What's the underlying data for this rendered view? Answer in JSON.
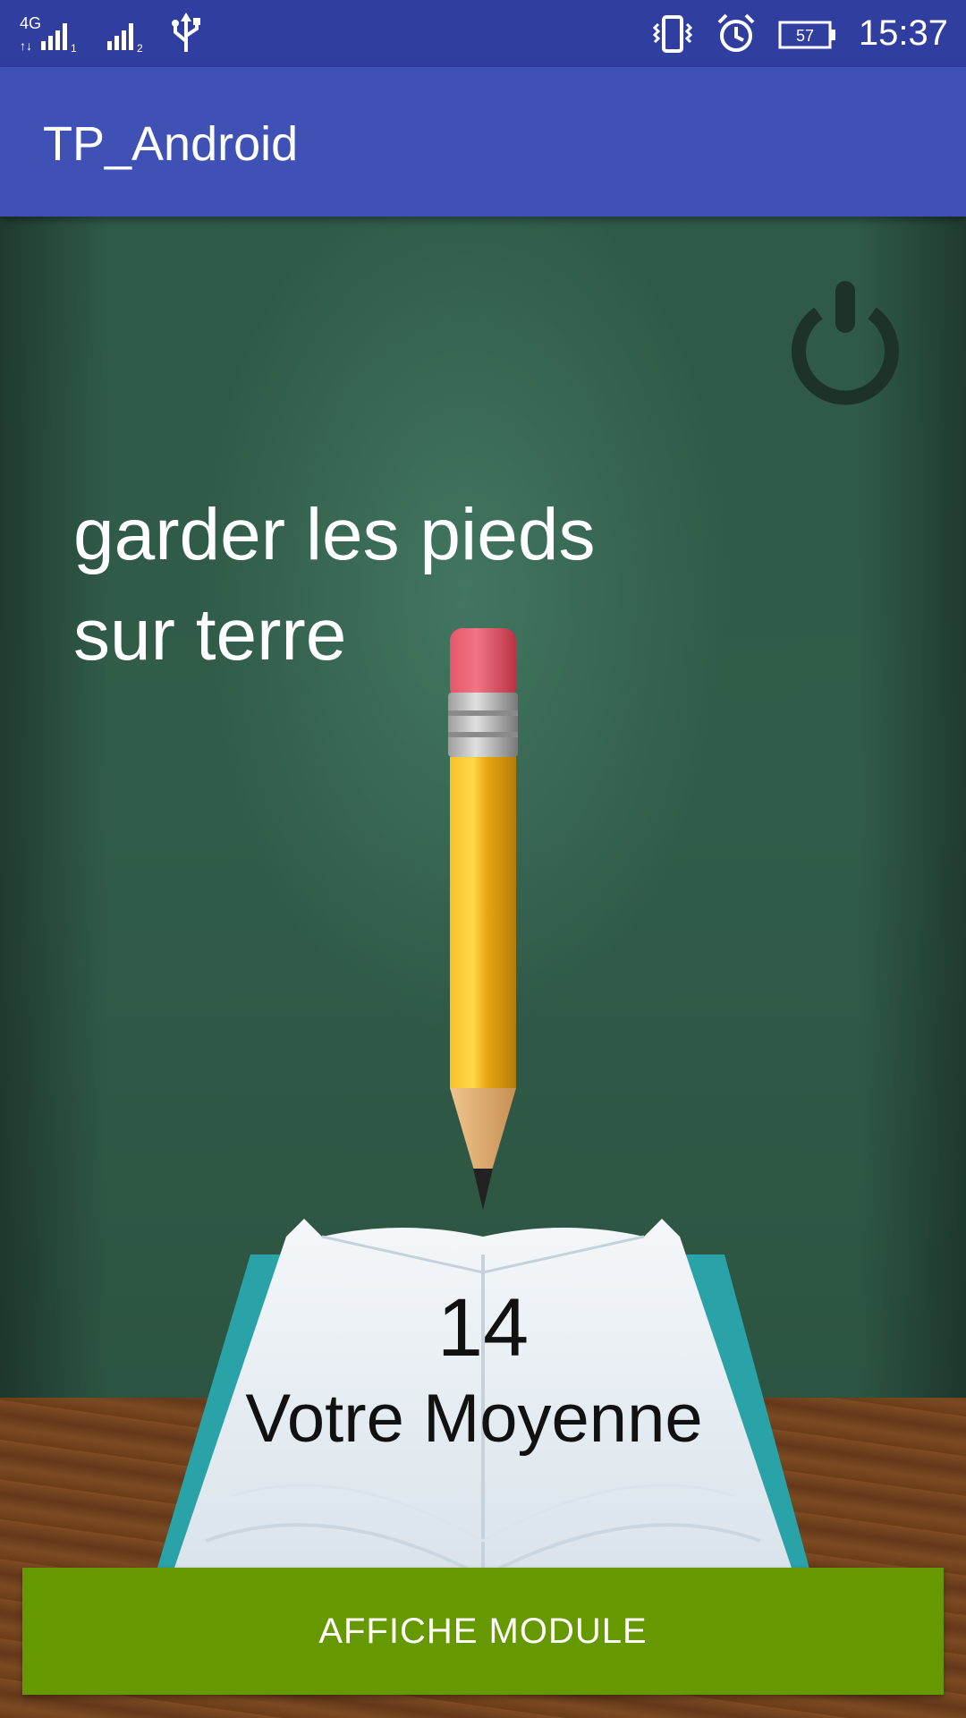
{
  "status_bar": {
    "network_type": "4G",
    "sim1_label": "1",
    "sim2_label": "2",
    "battery_level": "57",
    "time": "15:37",
    "icons": [
      "signal-icon",
      "usb-icon",
      "vibrate-icon",
      "alarm-icon",
      "battery-icon"
    ]
  },
  "app_bar": {
    "title": "TP_Android"
  },
  "main": {
    "motto": "garder les pieds sur terre",
    "average_value": "14",
    "average_label": "Votre Moyenne",
    "power_icon": "power-icon",
    "button_label": "AFFICHE MODULE"
  },
  "colors": {
    "status_bar": "#303f9f",
    "app_bar": "#3f51b5",
    "chalkboard": "#2f5a47",
    "button": "#669900"
  }
}
